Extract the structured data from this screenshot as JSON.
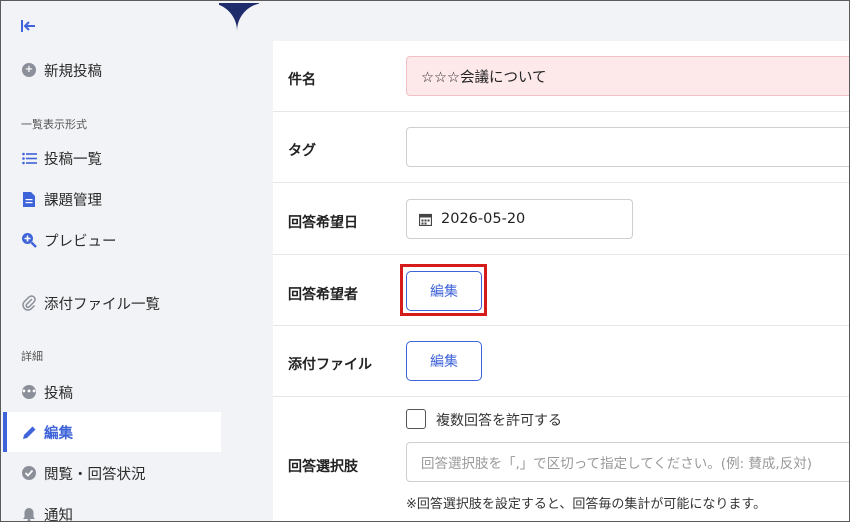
{
  "sidebar": {
    "new_post": "新規投稿",
    "section_view": "一覧表示形式",
    "items_view": [
      {
        "label": "投稿一覧",
        "icon": "list-icon"
      },
      {
        "label": "課題管理",
        "icon": "document-icon"
      },
      {
        "label": "プレビュー",
        "icon": "zoom-plus-icon"
      }
    ],
    "attachments": "添付ファイル一覧",
    "section_detail": "詳細",
    "items_detail": [
      {
        "label": "投稿",
        "icon": "chat-icon"
      },
      {
        "label": "編集",
        "icon": "pencil-icon"
      },
      {
        "label": "閲覧・回答状況",
        "icon": "check-circle-icon"
      },
      {
        "label": "通知",
        "icon": "bell-icon"
      }
    ]
  },
  "form": {
    "subject": {
      "label": "件名",
      "value": "☆☆☆会議について"
    },
    "tag": {
      "label": "タグ",
      "value": ""
    },
    "due_date": {
      "label": "回答希望日",
      "value": "2026-05-20"
    },
    "respondents": {
      "label": "回答希望者",
      "button": "編集"
    },
    "attachment": {
      "label": "添付ファイル",
      "button": "編集"
    },
    "choices": {
      "label": "回答選択肢",
      "checkbox_label": "複数回答を許可する",
      "placeholder": "回答選択肢を「,」で区切って指定してください。(例: 賛成,反対)",
      "note": "※回答選択肢を設定すると、回答毎の集計が可能になります。"
    }
  },
  "colors": {
    "accent": "#3f63d8",
    "band": "#1e2c6b",
    "highlight": "#d61b1b",
    "error_bg": "#fde8ea"
  }
}
